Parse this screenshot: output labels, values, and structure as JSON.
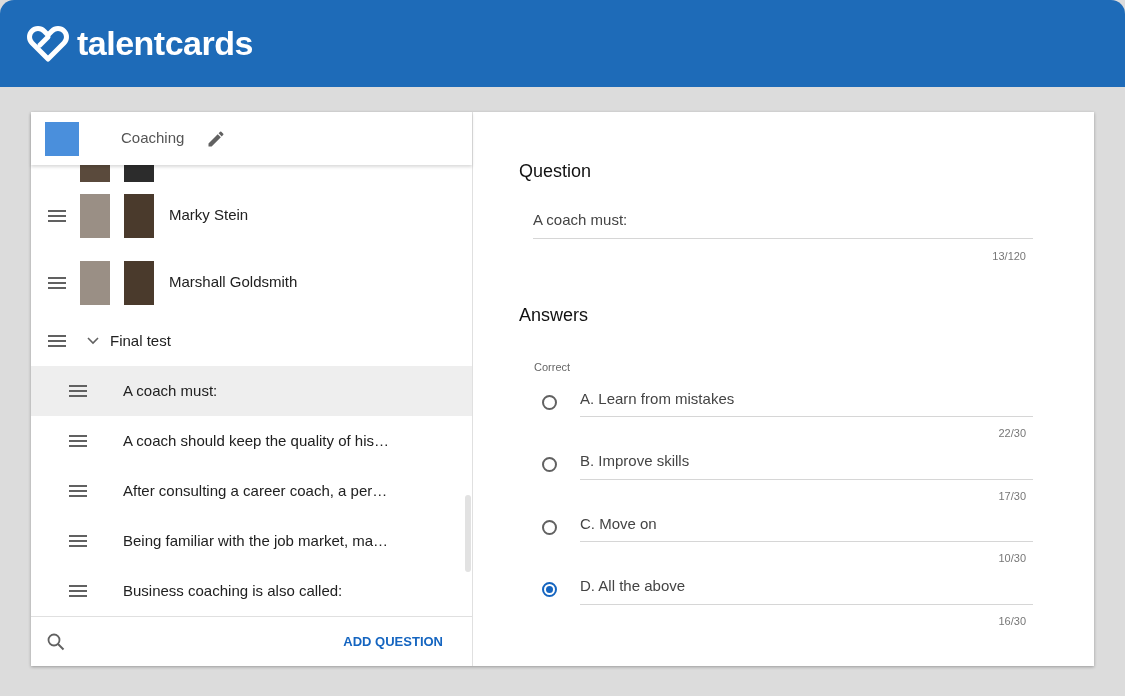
{
  "app": {
    "logo_text": "talentcards"
  },
  "deck": {
    "title": "Coaching"
  },
  "cards": [
    {
      "name": "Marky Stein"
    },
    {
      "name": "Marshall Goldsmith"
    }
  ],
  "test": {
    "name": "Final test",
    "expanded": true,
    "questions": [
      {
        "text": "A coach must:",
        "selected": true
      },
      {
        "text": "A coach should keep the quality of his…",
        "selected": false
      },
      {
        "text": "After consulting a career coach, a per…",
        "selected": false
      },
      {
        "text": "Being familiar with the job market, ma…",
        "selected": false
      },
      {
        "text": "Business coaching is also called:",
        "selected": false
      }
    ]
  },
  "footer": {
    "add_button": "ADD QUESTION"
  },
  "question": {
    "heading": "Question",
    "value": "A coach must:",
    "counter": "13/120"
  },
  "answers": {
    "heading": "Answers",
    "column_label": "Correct",
    "items": [
      {
        "value": "A. Learn from mistakes",
        "counter": "22/30",
        "selected": false
      },
      {
        "value": "B. Improve skills",
        "counter": "17/30",
        "selected": false
      },
      {
        "value": "C. Move on",
        "counter": "10/30",
        "selected": false
      },
      {
        "value": "D. All the above",
        "counter": "16/30",
        "selected": true
      }
    ]
  }
}
